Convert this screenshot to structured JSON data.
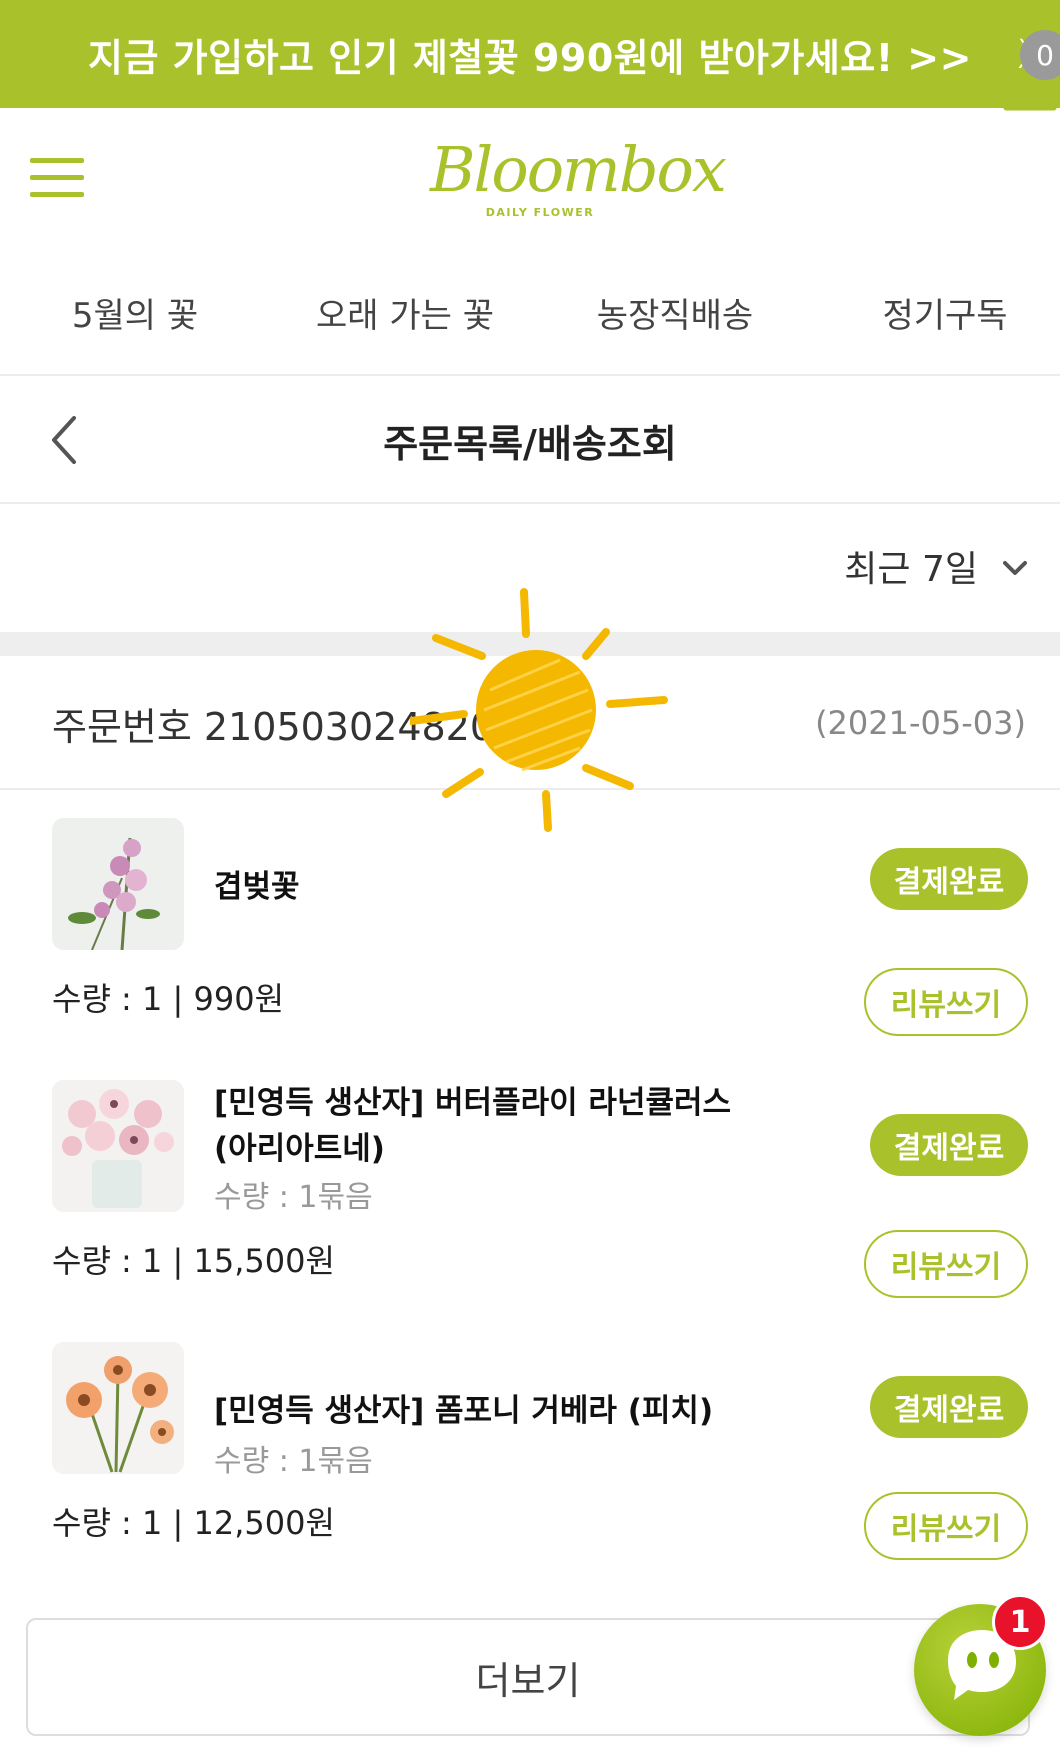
{
  "promo": {
    "text": "지금 가입하고 인기 제철꽃 990원에 받아가세요! >>",
    "close": "X"
  },
  "header": {
    "logo_script": "Bloombox",
    "logo_sub": "DAILY FLOWER",
    "cart_count": "0"
  },
  "nav": {
    "items": [
      {
        "label": "5월의 꽃"
      },
      {
        "label": "오래 가는 꽃"
      },
      {
        "label": "농장직배송"
      },
      {
        "label": "정기구독"
      }
    ]
  },
  "page": {
    "title": "주문목록/배송조회"
  },
  "filter": {
    "selected": "최근 7일"
  },
  "order": {
    "number_label": "주문번호 2105030248207",
    "date": "(2021-05-03)"
  },
  "items": [
    {
      "name": "겹벚꽃",
      "option": "",
      "qty_price": "수량 : 1 | 990원",
      "status": "결제완료",
      "review": "리뷰쓰기"
    },
    {
      "name": "[민영득 생산자] 버터플라이 라넌큘러스(아리아트네)",
      "option": "수량 : 1묶음",
      "qty_price": "수량 : 1 | 15,500원",
      "status": "결제완료",
      "review": "리뷰쓰기"
    },
    {
      "name": "[민영득 생산자] 폼포니 거베라 (피치)",
      "option": "수량 : 1묶음",
      "qty_price": "수량 : 1 | 12,500원",
      "status": "결제완료",
      "review": "리뷰쓰기"
    }
  ],
  "more_button": "더보기",
  "chat": {
    "badge": "1"
  },
  "colors": {
    "accent": "#a9c12a",
    "badge_red": "#e8132b",
    "sun": "#f5b800"
  }
}
